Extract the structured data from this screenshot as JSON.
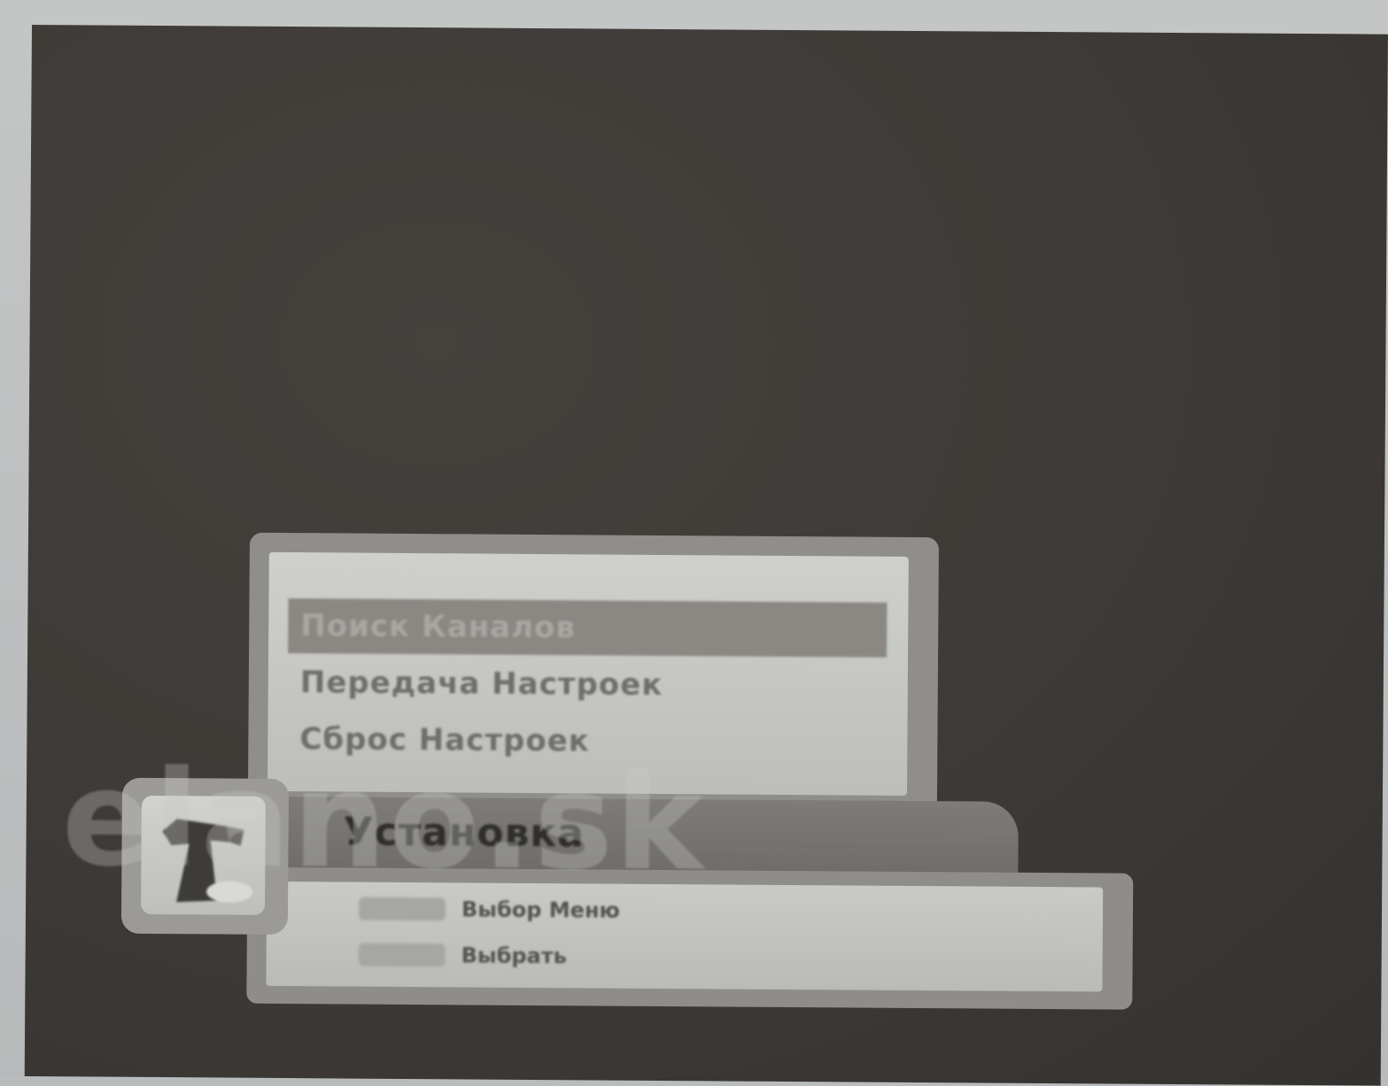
{
  "menu": {
    "items": [
      {
        "label": "Поиск Каналов",
        "selected": true
      },
      {
        "label": "Передача Настроек",
        "selected": false
      },
      {
        "label": "Сброс Настроек",
        "selected": false
      }
    ]
  },
  "title": {
    "label": "Установка",
    "icon": "installation-tool-icon"
  },
  "hints": [
    {
      "key": "navigation-keys-icon",
      "label": "Выбор Меню"
    },
    {
      "key": "ok-key-icon",
      "label": "Выбрать"
    }
  ],
  "watermark": "elano.sk",
  "colors": {
    "screen_bg": "#3d3a37",
    "panel": "#cfd0cd",
    "selection": "#8b8884"
  }
}
